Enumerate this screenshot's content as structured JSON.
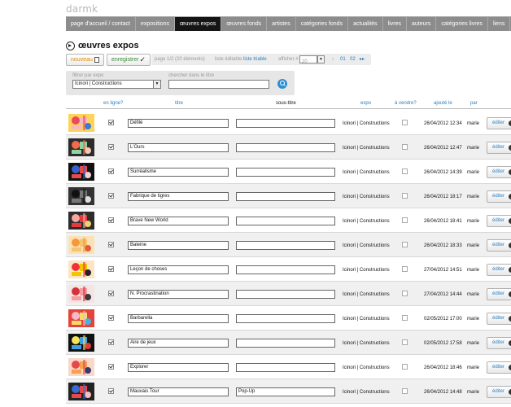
{
  "app": {
    "logo": "darmk"
  },
  "nav": {
    "items": [
      {
        "label": "page d'accueil / contact",
        "active": false
      },
      {
        "label": "expositions",
        "active": false
      },
      {
        "label": "œuvres expos",
        "active": true
      },
      {
        "label": "œuvres fonds",
        "active": false
      },
      {
        "label": "artistes",
        "active": false
      },
      {
        "label": "catégories fonds",
        "active": false
      },
      {
        "label": "actualités",
        "active": false
      },
      {
        "label": "livres",
        "active": false
      },
      {
        "label": "auteurs",
        "active": false
      },
      {
        "label": "catégories livres",
        "active": false
      },
      {
        "label": "liens",
        "active": false
      }
    ]
  },
  "page": {
    "title": "œuvres expos"
  },
  "toolbar": {
    "new_label": "nouveau",
    "save_label": "enregistrer",
    "pager_info": "page 1/2 (20 éléments)",
    "list_editable": "liste éditable",
    "list_sortable": "liste triable",
    "show_label": "afficher #",
    "show_value": "20",
    "page_prev": "‹",
    "page_1": "01",
    "page_2": "02",
    "page_next": "▸▸"
  },
  "filter": {
    "expo_label": "filtrer par expo",
    "expo_value": "Icinori | Constructions",
    "search_label": "chercher dans le titre",
    "search_value": ""
  },
  "table": {
    "headers": {
      "online": "en ligne?",
      "titre": "titre",
      "sous_titre": "sous-titre",
      "expo": "expo",
      "a_vendre": "à vendre?",
      "ajoute_le": "ajouté le",
      "par": "par"
    },
    "edit_label": "éditer",
    "rows": [
      {
        "titre": "Défilé",
        "sous_titre": "",
        "expo": "Icinori | Constructions",
        "date": "26/04/2012 12:34",
        "par": "marie",
        "online": true,
        "sell": false
      },
      {
        "titre": "L'Ours",
        "sous_titre": "",
        "expo": "Icinori | Constructions",
        "date": "26/04/2012 12:47",
        "par": "marie",
        "online": true,
        "sell": false
      },
      {
        "titre": "Surréalisme",
        "sous_titre": "",
        "expo": "Icinori | Constructions",
        "date": "26/04/2012 14:39",
        "par": "marie",
        "online": true,
        "sell": false
      },
      {
        "titre": "Fabrique de tigres",
        "sous_titre": "",
        "expo": "Icinori | Constructions",
        "date": "26/04/2012 18:17",
        "par": "marie",
        "online": true,
        "sell": false
      },
      {
        "titre": "Brave New World",
        "sous_titre": "",
        "expo": "Icinori | Constructions",
        "date": "26/04/2012 18:41",
        "par": "marie",
        "online": true,
        "sell": false
      },
      {
        "titre": "Baleine",
        "sous_titre": "",
        "expo": "Icinori | Constructions",
        "date": "26/04/2012 18:33",
        "par": "marie",
        "online": true,
        "sell": false
      },
      {
        "titre": "Leçon de choses",
        "sous_titre": "",
        "expo": "Icinori | Constructions",
        "date": "27/04/2012 14:51",
        "par": "marie",
        "online": true,
        "sell": false
      },
      {
        "titre": "N. Procrastination",
        "sous_titre": "",
        "expo": "Icinori | Constructions",
        "date": "27/04/2012 14:44",
        "par": "marie",
        "online": true,
        "sell": false
      },
      {
        "titre": "Barbarella",
        "sous_titre": "",
        "expo": "Icinori | Constructions",
        "date": "02/05/2012 17:00",
        "par": "marie",
        "online": true,
        "sell": false
      },
      {
        "titre": "Aire de jeux",
        "sous_titre": "",
        "expo": "Icinori | Constructions",
        "date": "02/05/2012 17:58",
        "par": "marie",
        "online": true,
        "sell": false
      },
      {
        "titre": "Explorer",
        "sous_titre": "",
        "expo": "Icinori | Constructions",
        "date": "26/04/2012 18:46",
        "par": "marie",
        "online": true,
        "sell": false
      },
      {
        "titre": "Mauvais Tour",
        "sous_titre": "Pop-Up",
        "expo": "Icinori | Constructions",
        "date": "26/04/2012 14:48",
        "par": "marie",
        "online": true,
        "sell": false
      }
    ]
  },
  "colors": {
    "nav_bg": "#8c8c8c",
    "nav_active": "#151515",
    "link_blue": "#2a7fc0",
    "new_orange": "#e58a00",
    "save_green": "#3a8a3a",
    "row_alt": "#f0f0f0"
  }
}
